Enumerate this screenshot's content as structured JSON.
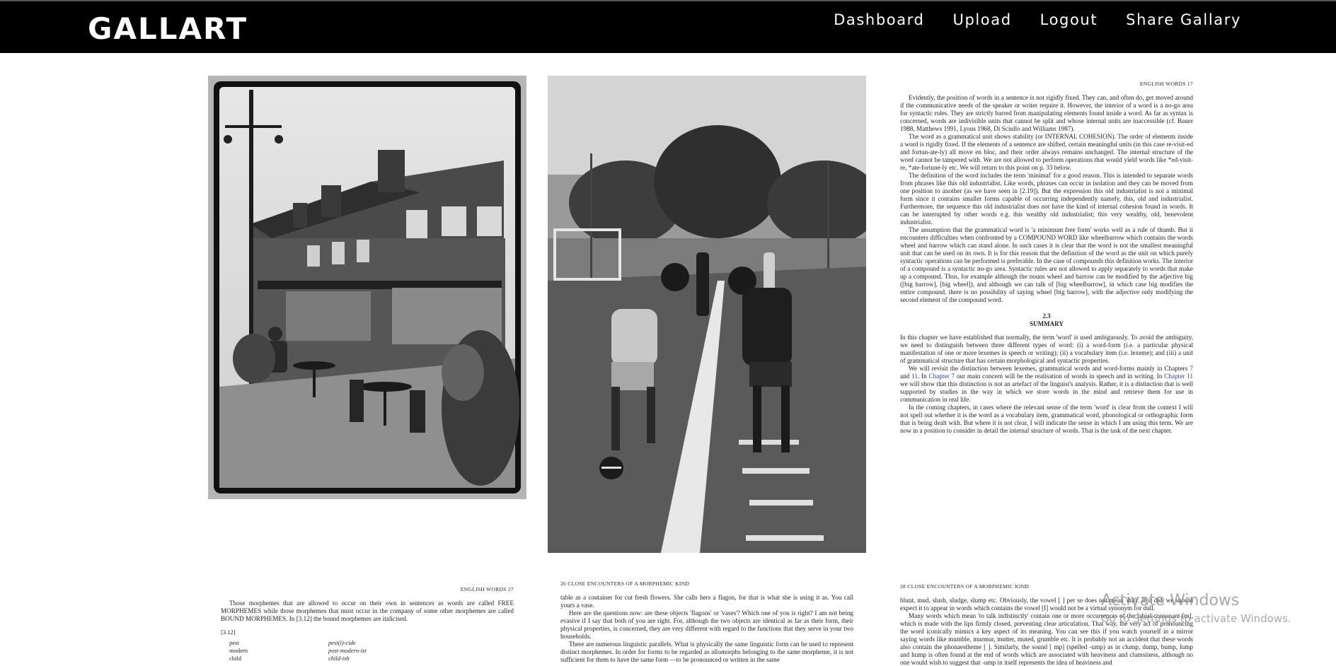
{
  "app": {
    "brand": "GALLART"
  },
  "nav": {
    "dashboard": "Dashboard",
    "upload": "Upload",
    "logout": "Logout",
    "share": "Share Gallary"
  },
  "gallery": {
    "tile3": {
      "running_head": "ENGLISH WORDS    17",
      "paragraphs": [
        "Evidently, the position of words in a sentence is not rigidly fixed. They can, and often do, get moved around if the communicative needs of the speaker or writer require it. However, the interior of a word is a no-go area for syntactic rules. They are strictly barred from manipulating elements found inside a word. As far as syntax is concerned, words are indivisible units that cannot be split and whose internal units are inaccessible (cf. Bauer 1988, Matthews 1991, Lyons 1968, Di Sciullo and Williams 1987).",
        "The word as a grammatical unit shows stability (or INTERNAL COHESION). The order of elements inside a word is rigidly fixed. If the elements of a sentence are shifted, certain meaningful units (in this case re-visit-ed and fortun-ate-ly) all move en bloc, and their order always remains unchanged. The internal structure of the word cannot be tampered with. We are not allowed to perform operations that would yield words like *ed-visit-re, *ate-fortune-ly etc. We will return to this point on p. 33 below.",
        "The definition of the word includes the term 'minimal' for a good reason. This is intended to separate words from phrases like this old industrialist. Like words, phrases can occur in isolation and they can be moved from one position to another (as we have seen in [2.19]). But the expression this old industrialist is not a minimal form since it contains smaller forms capable of occurring independently namely, this, old and industrialist. Furthermore, the sequence this old industrialist does not have the kind of internal cohesion found in words. It can be interrupted by other words e.g. this wealthy old industrialist; this very wealthy, old, benevolent industrialist.",
        "The assumption that the grammatical word is 'a minimum free form' works well as a rule of thumb. But it encounters difficulties when confronted by a COMPOUND WORD like wheelbarrow which contains the words wheel and barrow which can stand alone. In such cases it is clear that the word is not the smallest meaningful unit that can be used on its own. It is for this reason that the definition of the word as the unit on which purely syntactic operations can be performed is preferable. In the case of compounds this definition works. The interior of a compound is a syntactic no-go area. Syntactic rules are not allowed to apply separately to words that make up a compound. Thus, for example although the nouns wheel and barrow can be modified by the adjective big ([big barrow], [big wheel]), and although we can talk of [big wheelbarrow], in which case big modifies the entire compound, there is no possibility of saying wheel [big barrow], with the adjective only modifying the second element of the compound word."
      ],
      "section_number": "2.3",
      "section_title": "SUMMARY",
      "summary_p1": "In this chapter we have established that normally, the term 'word' is used ambiguously. To avoid the ambiguity, we need to distinguish between three different types of word: (i) a word-form (i.e. a particular physical manifestation of one or more lexemes in speech or writing); (ii) a vocabulary item (i.e. lexeme); and (iii) a unit of grammatical structure that has certain morphological and syntactic properties.",
      "summary_p2_a": "We will revisit the distinction between lexemes, grammatical words and word-forms mainly in Chapters ",
      "link_ch7": "7",
      "summary_p2_b": " and ",
      "link_ch11": "11",
      "summary_p2_c": ". In ",
      "link_chapter7": "Chapter 7",
      "summary_p2_d": " our main concern will be the realisation of words in speech and in writing. In ",
      "link_chapter11": "Chapter 11",
      "summary_p2_e": " we will show that this distinction is not an artefact of the linguist's analysis. Rather, it is a distinction that is well supported by studies in the way in which we store words in the mind and retrieve them for use in communication in real life.",
      "summary_p3": "In the coming chapters, in cases where the relevant sense of the term 'word' is clear from the context I will not spell out whether it is the word as a vocabulary item, grammatical word, phonological or orthographic form that is being dealt with. But where it is not clear, I will indicate the sense in which I am using this term. We are now in a position to consider in detail the internal structure of words. That is the task of the next chapter."
    },
    "tile4": {
      "running_head": "ENGLISH WORDS    27",
      "paragraph": "Those morphemes that are allowed to occur on their own in sentences as words are called FREE MORPHEMES while those morphemes that must occur in the company of some other morphemes are called BOUND MORPHEMES. In [3.12] the bound morphemes are italicised.",
      "example_label": "[3.12]",
      "rows": [
        {
          "left": "pest",
          "right": "pest(i)-cide"
        },
        {
          "left": "modern",
          "right": "post-modern-ist"
        },
        {
          "left": "child",
          "right": "child-ish"
        }
      ]
    },
    "tile5": {
      "running_head": "26    CLOSE ENCOUNTERS OF A MORPHEMIC KIND",
      "paragraphs": [
        "table as a container for cut fresh flowers. She calls hers a flagon, for that is what she is using it as. You call yours a vase.",
        "Here are the questions now: are these objects 'flagons' or 'vases'? Which one of you is right? I am not being evasive if I say that both of you are right. For, although the two objects are identical as far as their form, their physical properties, is concerned, they are very different with regard to the functions that they serve in your two households.",
        "There are numerous linguistic parallels. What is physically the same linguistic form can be used to represent distinct morphemes. In order for forms to be regarded as allomorphs belonging to the same morpheme, it is not sufficient for them to have the same form —to be pronounced or written in the same"
      ]
    },
    "tile6": {
      "running_head": "28    CLOSE ENCOUNTERS OF A MORPHEMIC KIND",
      "paragraphs": [
        "blunt, mud, slush, sludge, slump etc. Obviously, the vowel [ ] per se does not mean 'dull'. If it did, we should expect it to appear in words which contains the vowel [I] would not be a virtual synonym for dull.",
        "Many words which mean 'to talk indistinctly' contain one or more occurrences of the labial consonant [m], which is made with the lips firmly closed, preventing clear articulation. That way, the very act of pronouncing the word iconically mimics a key aspect of its meaning. You can see this if you watch yourself in a mirror saying words like mumble, murmur, mutter, muted, grumble etc. It is probably not an accident that these words also contain the phonaestheme [ ]. Similarly, the sound [ mp] (spelled -ump) as in clump, dump, bump, lump and hump is often found at the end of words which are associated with heaviness and clumsiness, although no one would wish to suggest that -ump in itself represents the idea of heaviness and"
      ]
    }
  },
  "watermark": {
    "line1": "Activate Windows",
    "line2": "Go to Settings to activate Windows."
  }
}
